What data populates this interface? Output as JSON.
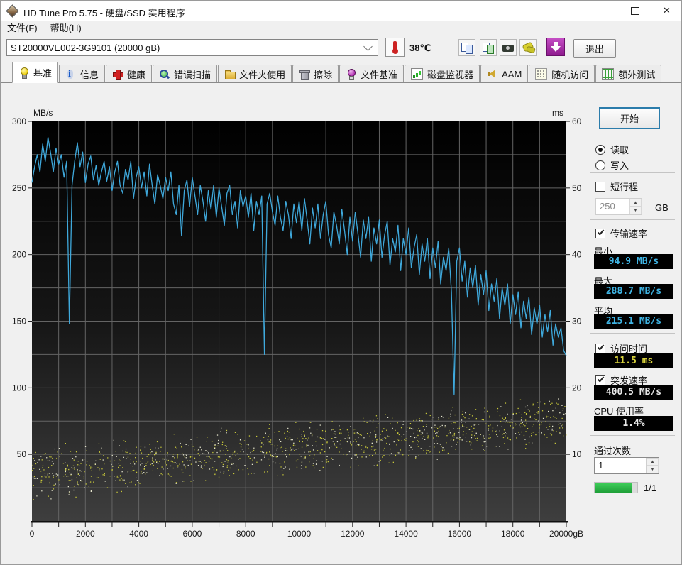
{
  "window": {
    "title": "HD Tune Pro 5.75 - 硬盘/SSD 实用程序"
  },
  "menu": {
    "items": [
      "文件(F)",
      "帮助(H)"
    ]
  },
  "toolbar": {
    "drive": "ST20000VE002-3G9101 (20000 gB)",
    "temperature": "38℃",
    "exit_label": "退出",
    "buttons": [
      {
        "name": "copy-text-button",
        "icon": "ic-doc2"
      },
      {
        "name": "copy-image-button",
        "icon": "ic-doc2g"
      },
      {
        "name": "screenshot-button",
        "icon": "ic-camera"
      },
      {
        "name": "options-button",
        "icon": "ic-options"
      },
      {
        "name": "save-results-button",
        "icon": "ic-down"
      }
    ]
  },
  "tabs": [
    {
      "label": "基准",
      "icon": "i-bulb",
      "active": true
    },
    {
      "label": "信息",
      "icon": "i-info",
      "active": false
    },
    {
      "label": "健康",
      "icon": "i-health",
      "active": false
    },
    {
      "label": "错误扫描",
      "icon": "i-scan",
      "active": false
    },
    {
      "label": "文件夹使用",
      "icon": "i-folder",
      "active": false
    },
    {
      "label": "擦除",
      "icon": "i-trash",
      "active": false
    },
    {
      "label": "文件基准",
      "icon": "i-bulbp",
      "active": false
    },
    {
      "label": "磁盘监视器",
      "icon": "i-monitor",
      "active": false
    },
    {
      "label": "AAM",
      "icon": "i-speaker",
      "active": false
    },
    {
      "label": "随机访问",
      "icon": "i-random",
      "active": false
    },
    {
      "label": "额外测试",
      "icon": "i-extra",
      "active": false
    }
  ],
  "chart_data": {
    "type": "line",
    "title": "HD Tune read benchmark",
    "left_axis": {
      "label": "MB/s",
      "min": 0,
      "max": 300,
      "ticks": [
        300,
        250,
        200,
        150,
        100,
        50
      ]
    },
    "right_axis": {
      "label": "ms",
      "min": 0,
      "max": 60,
      "ticks": [
        60,
        50,
        40,
        30,
        20,
        10
      ]
    },
    "x_axis": {
      "min": 0,
      "max": 20000,
      "grid_step": 1000,
      "label_step": 2000,
      "last_label": "20000gB"
    },
    "grid": true,
    "bg_gradient": [
      "#000000",
      "#161616",
      "#3e3e3e"
    ],
    "series": [
      {
        "name": "transfer-rate",
        "type": "line",
        "color": "#3fa9dc",
        "unit": "MB/s",
        "x_step_gb": 100,
        "values": [
          254,
          266,
          275,
          262,
          283,
          270,
          288,
          276,
          262,
          280,
          268,
          275,
          258,
          270,
          148,
          252,
          270,
          284,
          266,
          277,
          254,
          268,
          274,
          256,
          267,
          252,
          262,
          270,
          255,
          266,
          248,
          262,
          270,
          252,
          246,
          264,
          256,
          270,
          242,
          258,
          266,
          250,
          262,
          244,
          268,
          252,
          238,
          260,
          252,
          242,
          258,
          248,
          262,
          238,
          230,
          252,
          214,
          248,
          256,
          236,
          258,
          244,
          230,
          252,
          240,
          225,
          248,
          234,
          252,
          228,
          250,
          236,
          222,
          246,
          252,
          230,
          240,
          220,
          248,
          236,
          244,
          228,
          246,
          218,
          240,
          230,
          244,
          125,
          238,
          246,
          232,
          222,
          244,
          228,
          218,
          240,
          230,
          212,
          238,
          224,
          240,
          218,
          242,
          226,
          208,
          235,
          220,
          238,
          212,
          230,
          240,
          215,
          205,
          232,
          222,
          208,
          234,
          218,
          200,
          228,
          210,
          232,
          216,
          198,
          226,
          212,
          228,
          195,
          220,
          208,
          226,
          198,
          215,
          225,
          192,
          212,
          202,
          222,
          188,
          212,
          200,
          220,
          190,
          205,
          215,
          185,
          208,
          195,
          212,
          182,
          205,
          190,
          210,
          178,
          198,
          188,
          205,
          172,
          95,
          195,
          205,
          180,
          195,
          168,
          190,
          175,
          192,
          162,
          185,
          170,
          188,
          158,
          178,
          165,
          182,
          152,
          175,
          162,
          178,
          148,
          170,
          155,
          172,
          145,
          165,
          152,
          168,
          140,
          160,
          148,
          162,
          138,
          155,
          142,
          158,
          132,
          148,
          138,
          145,
          128,
          124
        ]
      },
      {
        "name": "access-time",
        "type": "scatter",
        "unit": "ms",
        "colors": [
          "#c6c63a",
          "#e4e4cc"
        ],
        "points": {
          "count": 1250,
          "seed": 4242,
          "ms_start": 7,
          "ms_end": 15,
          "spread": 4.2,
          "min": 1.8,
          "max": 19.8
        }
      }
    ]
  },
  "panel": {
    "start_label": "开始",
    "mode": [
      {
        "label": "读取",
        "selected": true
      },
      {
        "label": "写入",
        "selected": false
      }
    ],
    "short_stroke": {
      "label": "短行程",
      "checked": false,
      "value": "250",
      "unit": "GB"
    },
    "transfer": {
      "label": "传输速率",
      "checked": true,
      "min_label": "最小",
      "min": "94.9 MB/s",
      "max_label": "最大",
      "max": "288.7 MB/s",
      "avg_label": "平均",
      "avg": "215.1 MB/s"
    },
    "access": {
      "label": "访问时间",
      "checked": true,
      "value": "11.5 ms"
    },
    "burst": {
      "label": "突发速率",
      "checked": true,
      "value": "400.5 MB/s"
    },
    "cpu": {
      "label": "CPU 使用率",
      "value": "1.4%"
    },
    "passes": {
      "label": "通过次数",
      "value": "1",
      "progress_label": "1/1",
      "progress_pct": 86
    },
    "lcd_colors": {
      "rate": "#3fb4e4",
      "access": "#d8d23c",
      "plain": "#e8e8e8"
    }
  }
}
